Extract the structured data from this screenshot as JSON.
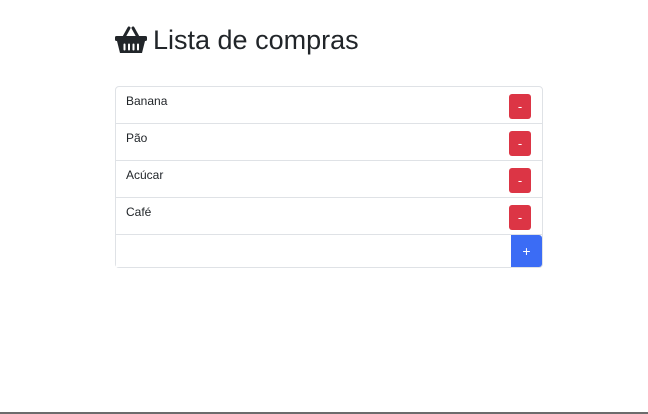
{
  "header": {
    "icon": "basket-icon",
    "title": "Lista de compras"
  },
  "list": {
    "items": [
      {
        "label": "Banana",
        "remove_label": "-"
      },
      {
        "label": "Pão",
        "remove_label": "-"
      },
      {
        "label": "Acúcar",
        "remove_label": "-"
      },
      {
        "label": "Café",
        "remove_label": "-"
      }
    ]
  },
  "add": {
    "value": "",
    "placeholder": "",
    "button_label": "+"
  },
  "colors": {
    "remove": "#dc3545",
    "add": "#3b6cf5",
    "border": "#dfe2e6"
  }
}
